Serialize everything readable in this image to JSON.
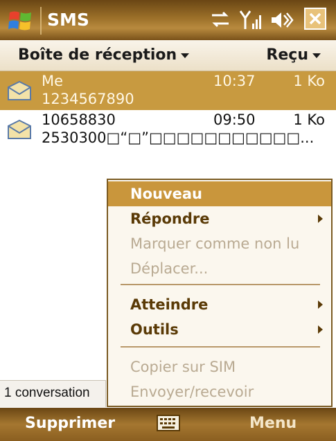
{
  "titlebar": {
    "title": "SMS"
  },
  "header": {
    "folder": "Boîte de réception",
    "sort": "Reçu"
  },
  "messages": [
    {
      "from": "Me",
      "time": "10:37",
      "size": "1 Ko",
      "body": "1234567890"
    },
    {
      "from": "10658830",
      "time": "09:50",
      "size": "1 Ko",
      "body": "2530300□“□”□□□□□□□□□□□..."
    }
  ],
  "status": {
    "text": "1 conversation"
  },
  "menu": {
    "items": [
      {
        "label": "Nouveau",
        "state": "highlight"
      },
      {
        "label": "Répondre",
        "state": "enabled",
        "submenu": true
      },
      {
        "label": "Marquer comme non lu",
        "state": "disabled"
      },
      {
        "label": "Déplacer...",
        "state": "disabled"
      },
      {
        "label": "Atteindre",
        "state": "enabled",
        "submenu": true
      },
      {
        "label": "Outils",
        "state": "enabled",
        "submenu": true
      },
      {
        "label": "Copier sur SIM",
        "state": "disabled"
      },
      {
        "label": "Envoyer/recevoir",
        "state": "disabled"
      }
    ]
  },
  "softkeys": {
    "left": "Supprimer",
    "right": "Menu"
  },
  "icons": [
    "windows-flag-icon",
    "connectivity-icon",
    "signal-icon",
    "volume-icon",
    "close-icon",
    "envelope-icon",
    "keyboard-icon"
  ],
  "colors": {
    "accent": "#c9963c",
    "bar_dark": "#6a4614",
    "menu_text": "#5a3a06",
    "disabled_text": "#b9aa92"
  }
}
